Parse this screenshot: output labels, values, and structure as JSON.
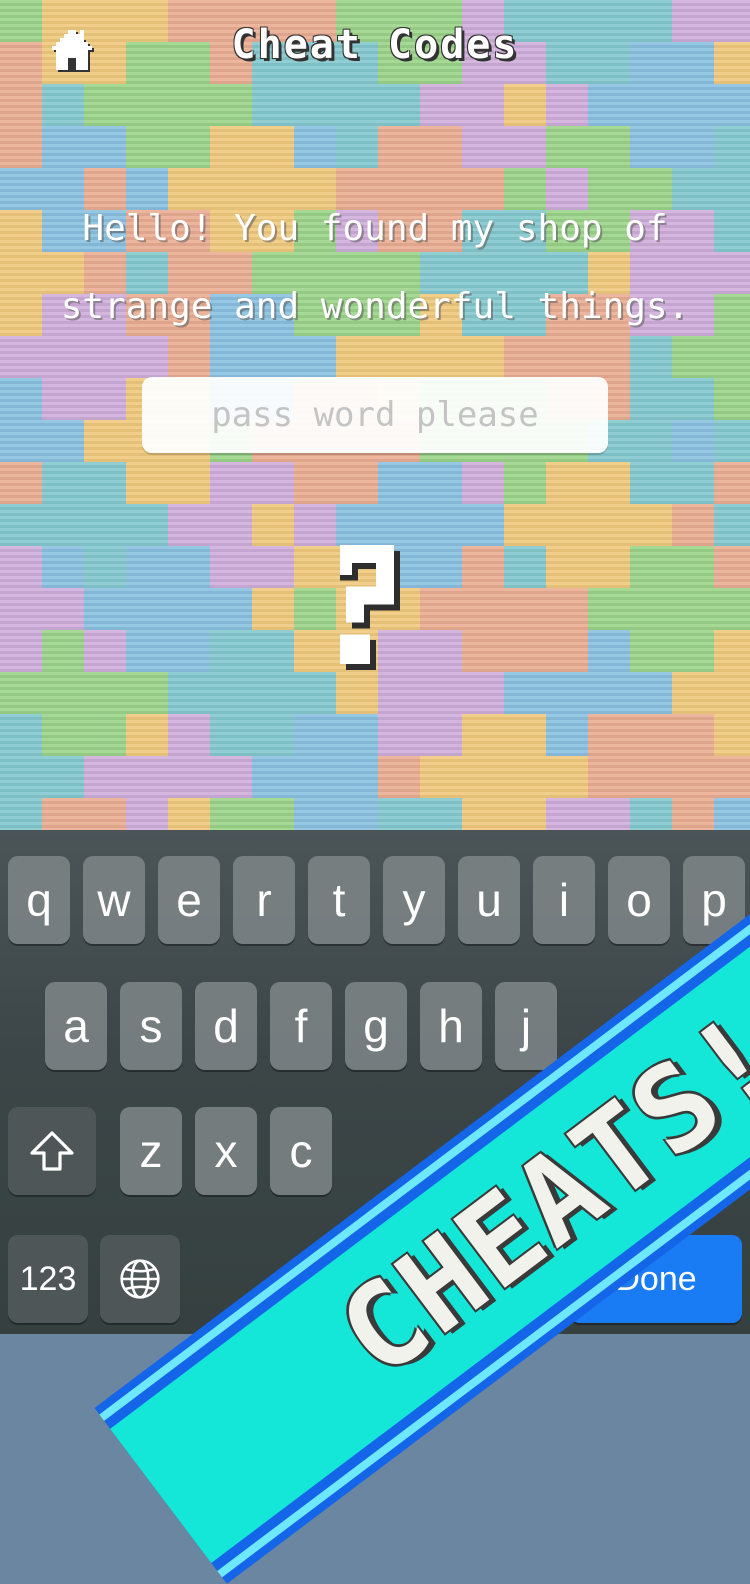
{
  "header": {
    "title": "Cheat Codes",
    "home_icon": "home-icon"
  },
  "main": {
    "greeting_line1": "Hello! You found my shop of",
    "greeting_line2": "strange and wonderful things.",
    "password_placeholder": "pass word please",
    "password_value": "",
    "mystery_icon": "question-mark-icon"
  },
  "background": {
    "palette": [
      "#8fcf7a",
      "#e7a284",
      "#eec26d",
      "#7ab9dc",
      "#c9a3d6",
      "#74c2c8"
    ]
  },
  "keyboard": {
    "row1": [
      "q",
      "w",
      "e",
      "r",
      "t",
      "y",
      "u",
      "i",
      "o",
      "p"
    ],
    "row2": [
      "a",
      "s",
      "d",
      "f",
      "g",
      "h",
      "j"
    ],
    "row3": [
      "z",
      "x",
      "c"
    ],
    "numbers_label": "123",
    "shift_icon": "shift-arrow-icon",
    "globe_icon": "globe-icon",
    "done_label": "Done",
    "accent_color": "#1a7cf5"
  },
  "banner": {
    "text": "CHEATS!",
    "core_color": "#14e6d8",
    "edge_color": "#1565e8"
  }
}
